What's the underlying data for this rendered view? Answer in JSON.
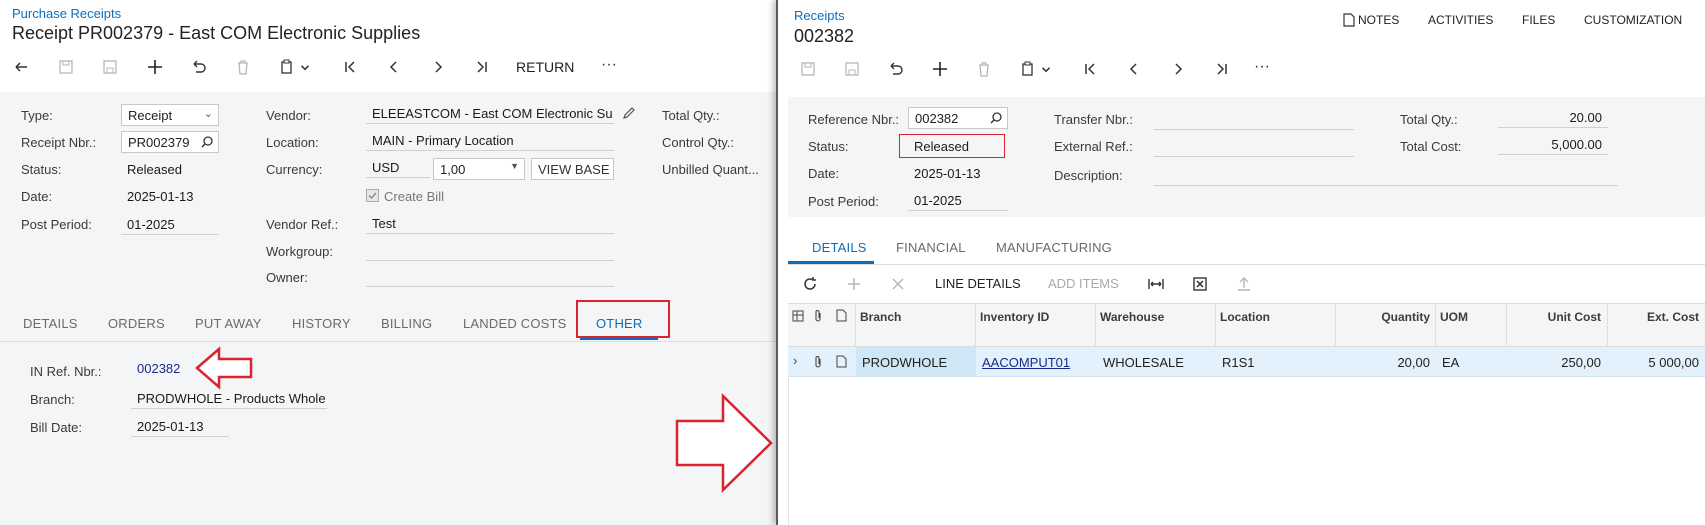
{
  "left": {
    "breadcrumb": "Purchase Receipts",
    "title": "Receipt PR002379 - East COM Electronic Supplies",
    "toolbar": {
      "return_label": "RETURN",
      "more": "···"
    },
    "form": {
      "type_label": "Type:",
      "type_value": "Receipt",
      "receipt_nbr_label": "Receipt Nbr.:",
      "receipt_nbr_value": "PR002379",
      "status_label": "Status:",
      "status_value": "Released",
      "date_label": "Date:",
      "date_value": "2025-01-13",
      "post_period_label": "Post Period:",
      "post_period_value": "01-2025",
      "vendor_label": "Vendor:",
      "vendor_value": "ELEEASTCOM - East COM Electronic Su",
      "location_label": "Location:",
      "location_value": "MAIN - Primary Location",
      "currency_label": "Currency:",
      "currency_value": "USD",
      "rate_value": "1,00",
      "view_base_label": "VIEW BASE",
      "create_bill_label": "Create Bill",
      "vendor_ref_label": "Vendor Ref.:",
      "vendor_ref_value": "Test",
      "workgroup_label": "Workgroup:",
      "owner_label": "Owner:",
      "total_qty_label": "Total Qty.:",
      "control_qty_label": "Control Qty.:",
      "unbilled_qty_label": "Unbilled Quant..."
    },
    "tabs": [
      "DETAILS",
      "ORDERS",
      "PUT AWAY",
      "HISTORY",
      "BILLING",
      "LANDED COSTS",
      "OTHER"
    ],
    "other": {
      "in_ref_label": "IN Ref. Nbr.:",
      "in_ref_value": "002382",
      "branch_label": "Branch:",
      "branch_value": "PRODWHOLE - Products Whole",
      "bill_date_label": "Bill Date:",
      "bill_date_value": "2025-01-13"
    }
  },
  "right": {
    "breadcrumb": "Receipts",
    "title": "002382",
    "top_links": {
      "notes": "NOTES",
      "activities": "ACTIVITIES",
      "files": "FILES",
      "customization": "CUSTOMIZATION"
    },
    "toolbar": {
      "more": "···"
    },
    "form": {
      "ref_nbr_label": "Reference Nbr.:",
      "ref_nbr_value": "002382",
      "status_label": "Status:",
      "status_value": "Released",
      "date_label": "Date:",
      "date_value": "2025-01-13",
      "post_period_label": "Post Period:",
      "post_period_value": "01-2025",
      "transfer_nbr_label": "Transfer Nbr.:",
      "external_ref_label": "External Ref.:",
      "description_label": "Description:",
      "total_qty_label": "Total Qty.:",
      "total_qty_value": "20.00",
      "total_cost_label": "Total Cost:",
      "total_cost_value": "5,000.00"
    },
    "tabs": [
      "DETAILS",
      "FINANCIAL",
      "MANUFACTURING"
    ],
    "grid_toolbar": {
      "line_details": "LINE DETAILS",
      "add_items": "ADD ITEMS"
    },
    "columns": [
      "Branch",
      "Inventory ID",
      "Warehouse",
      "Location",
      "Quantity",
      "UOM",
      "Unit Cost",
      "Ext. Cost"
    ],
    "rows": [
      {
        "branch": "PRODWHOLE",
        "inventory_id": "AACOMPUT01",
        "warehouse": "WHOLESALE",
        "location": "R1S1",
        "quantity": "20,00",
        "uom": "EA",
        "unit_cost": "250,00",
        "ext_cost": "5 000,00"
      }
    ]
  },
  "colors": {
    "accent": "#0a6ebd",
    "highlight": "#d9232e",
    "row_bg": "#e2f1fb",
    "header_bg": "#f4f5f7"
  }
}
